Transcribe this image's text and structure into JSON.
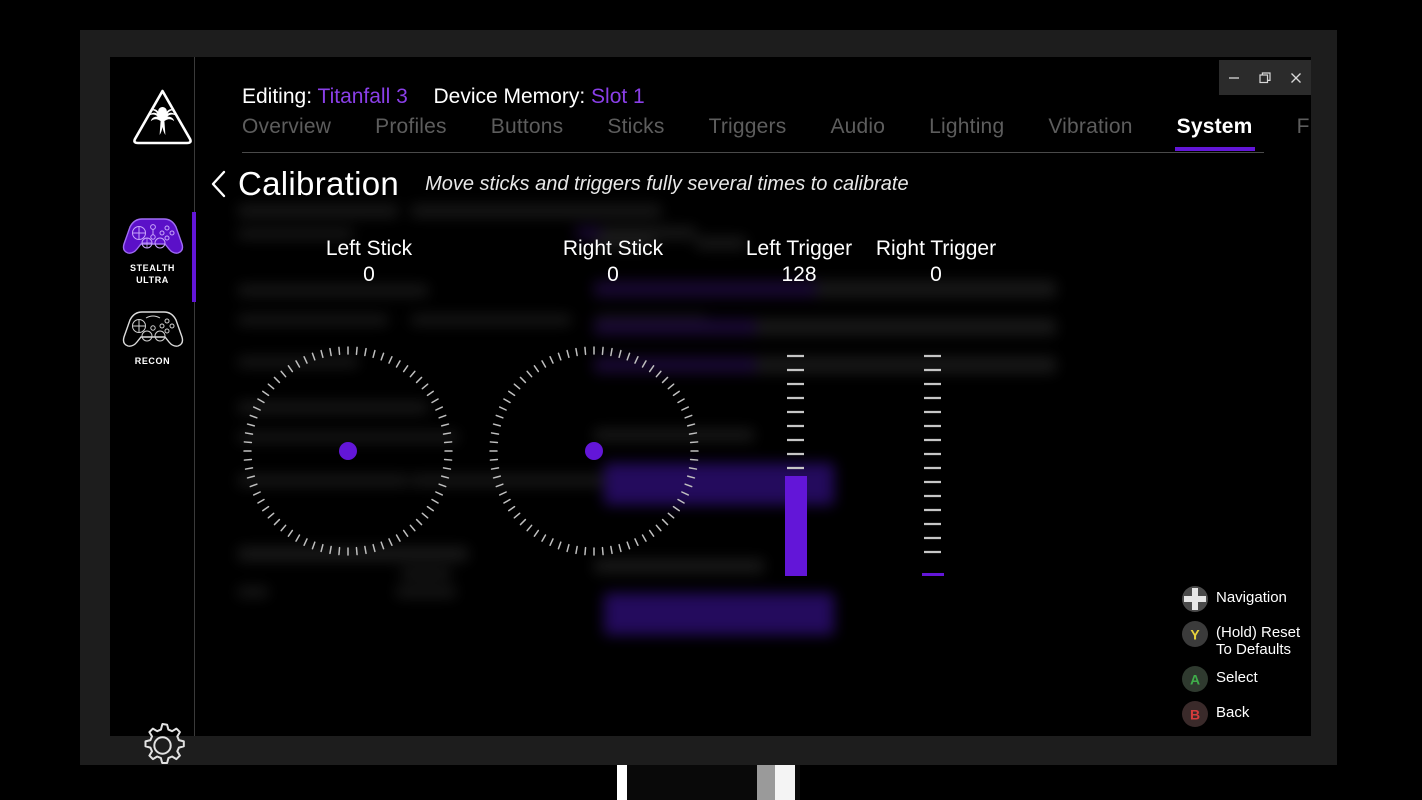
{
  "window": {
    "controls": [
      {
        "name": "minimize",
        "glyph": "minimize-icon"
      },
      {
        "name": "restore",
        "glyph": "restore-icon"
      },
      {
        "name": "close",
        "glyph": "close-icon"
      }
    ]
  },
  "sidebar": {
    "brand": "turtle-beach-palm-logo",
    "devices": [
      {
        "label_line1": "STEALTH",
        "label_line2": "ULTRA",
        "selected": true,
        "color": "#7b2ff7"
      },
      {
        "label_line1": "RECON",
        "label_line2": "",
        "selected": false,
        "color": "#e8e8e8"
      }
    ],
    "settings_icon": "gear-icon"
  },
  "header": {
    "editing_label": "Editing:",
    "editing_value": "Titanfall 3",
    "memory_label": "Device Memory:",
    "memory_value": "Slot 1",
    "accent": "#8a3fe8"
  },
  "tabs": [
    {
      "label": "Overview",
      "active": false
    },
    {
      "label": "Profiles",
      "active": false
    },
    {
      "label": "Buttons",
      "active": false
    },
    {
      "label": "Sticks",
      "active": false
    },
    {
      "label": "Triggers",
      "active": false
    },
    {
      "label": "Audio",
      "active": false
    },
    {
      "label": "Lighting",
      "active": false
    },
    {
      "label": "Vibration",
      "active": false
    },
    {
      "label": "System",
      "active": true
    },
    {
      "label": "Firmware",
      "active": false
    }
  ],
  "section": {
    "back_icon": "chevron-left-icon",
    "title": "Calibration",
    "subtitle": "Move sticks and triggers fully several times to calibrate"
  },
  "readouts": {
    "sticks": [
      {
        "name": "Left Stick",
        "value": "0"
      },
      {
        "name": "Right Stick",
        "value": "0"
      }
    ],
    "triggers": [
      {
        "name": "Left Trigger",
        "value": "128",
        "percent": 50
      },
      {
        "name": "Right Trigger",
        "value": "0",
        "percent": 0
      }
    ]
  },
  "legend": [
    {
      "icon": "dpad-icon",
      "label": "Navigation",
      "color": "#d9d9d9"
    },
    {
      "icon": "y-button-icon",
      "glyph": "Y",
      "label": "(Hold) Reset To Defaults",
      "color": "#e8d33c"
    },
    {
      "icon": "a-button-icon",
      "glyph": "A",
      "label": "Select",
      "color": "#3fae4a"
    },
    {
      "icon": "b-button-icon",
      "glyph": "B",
      "label": "Back",
      "color": "#d63c3c"
    }
  ],
  "theme": {
    "accent_purple": "#6316d8",
    "bg": "#000000",
    "frame": "#1d1d1d"
  }
}
